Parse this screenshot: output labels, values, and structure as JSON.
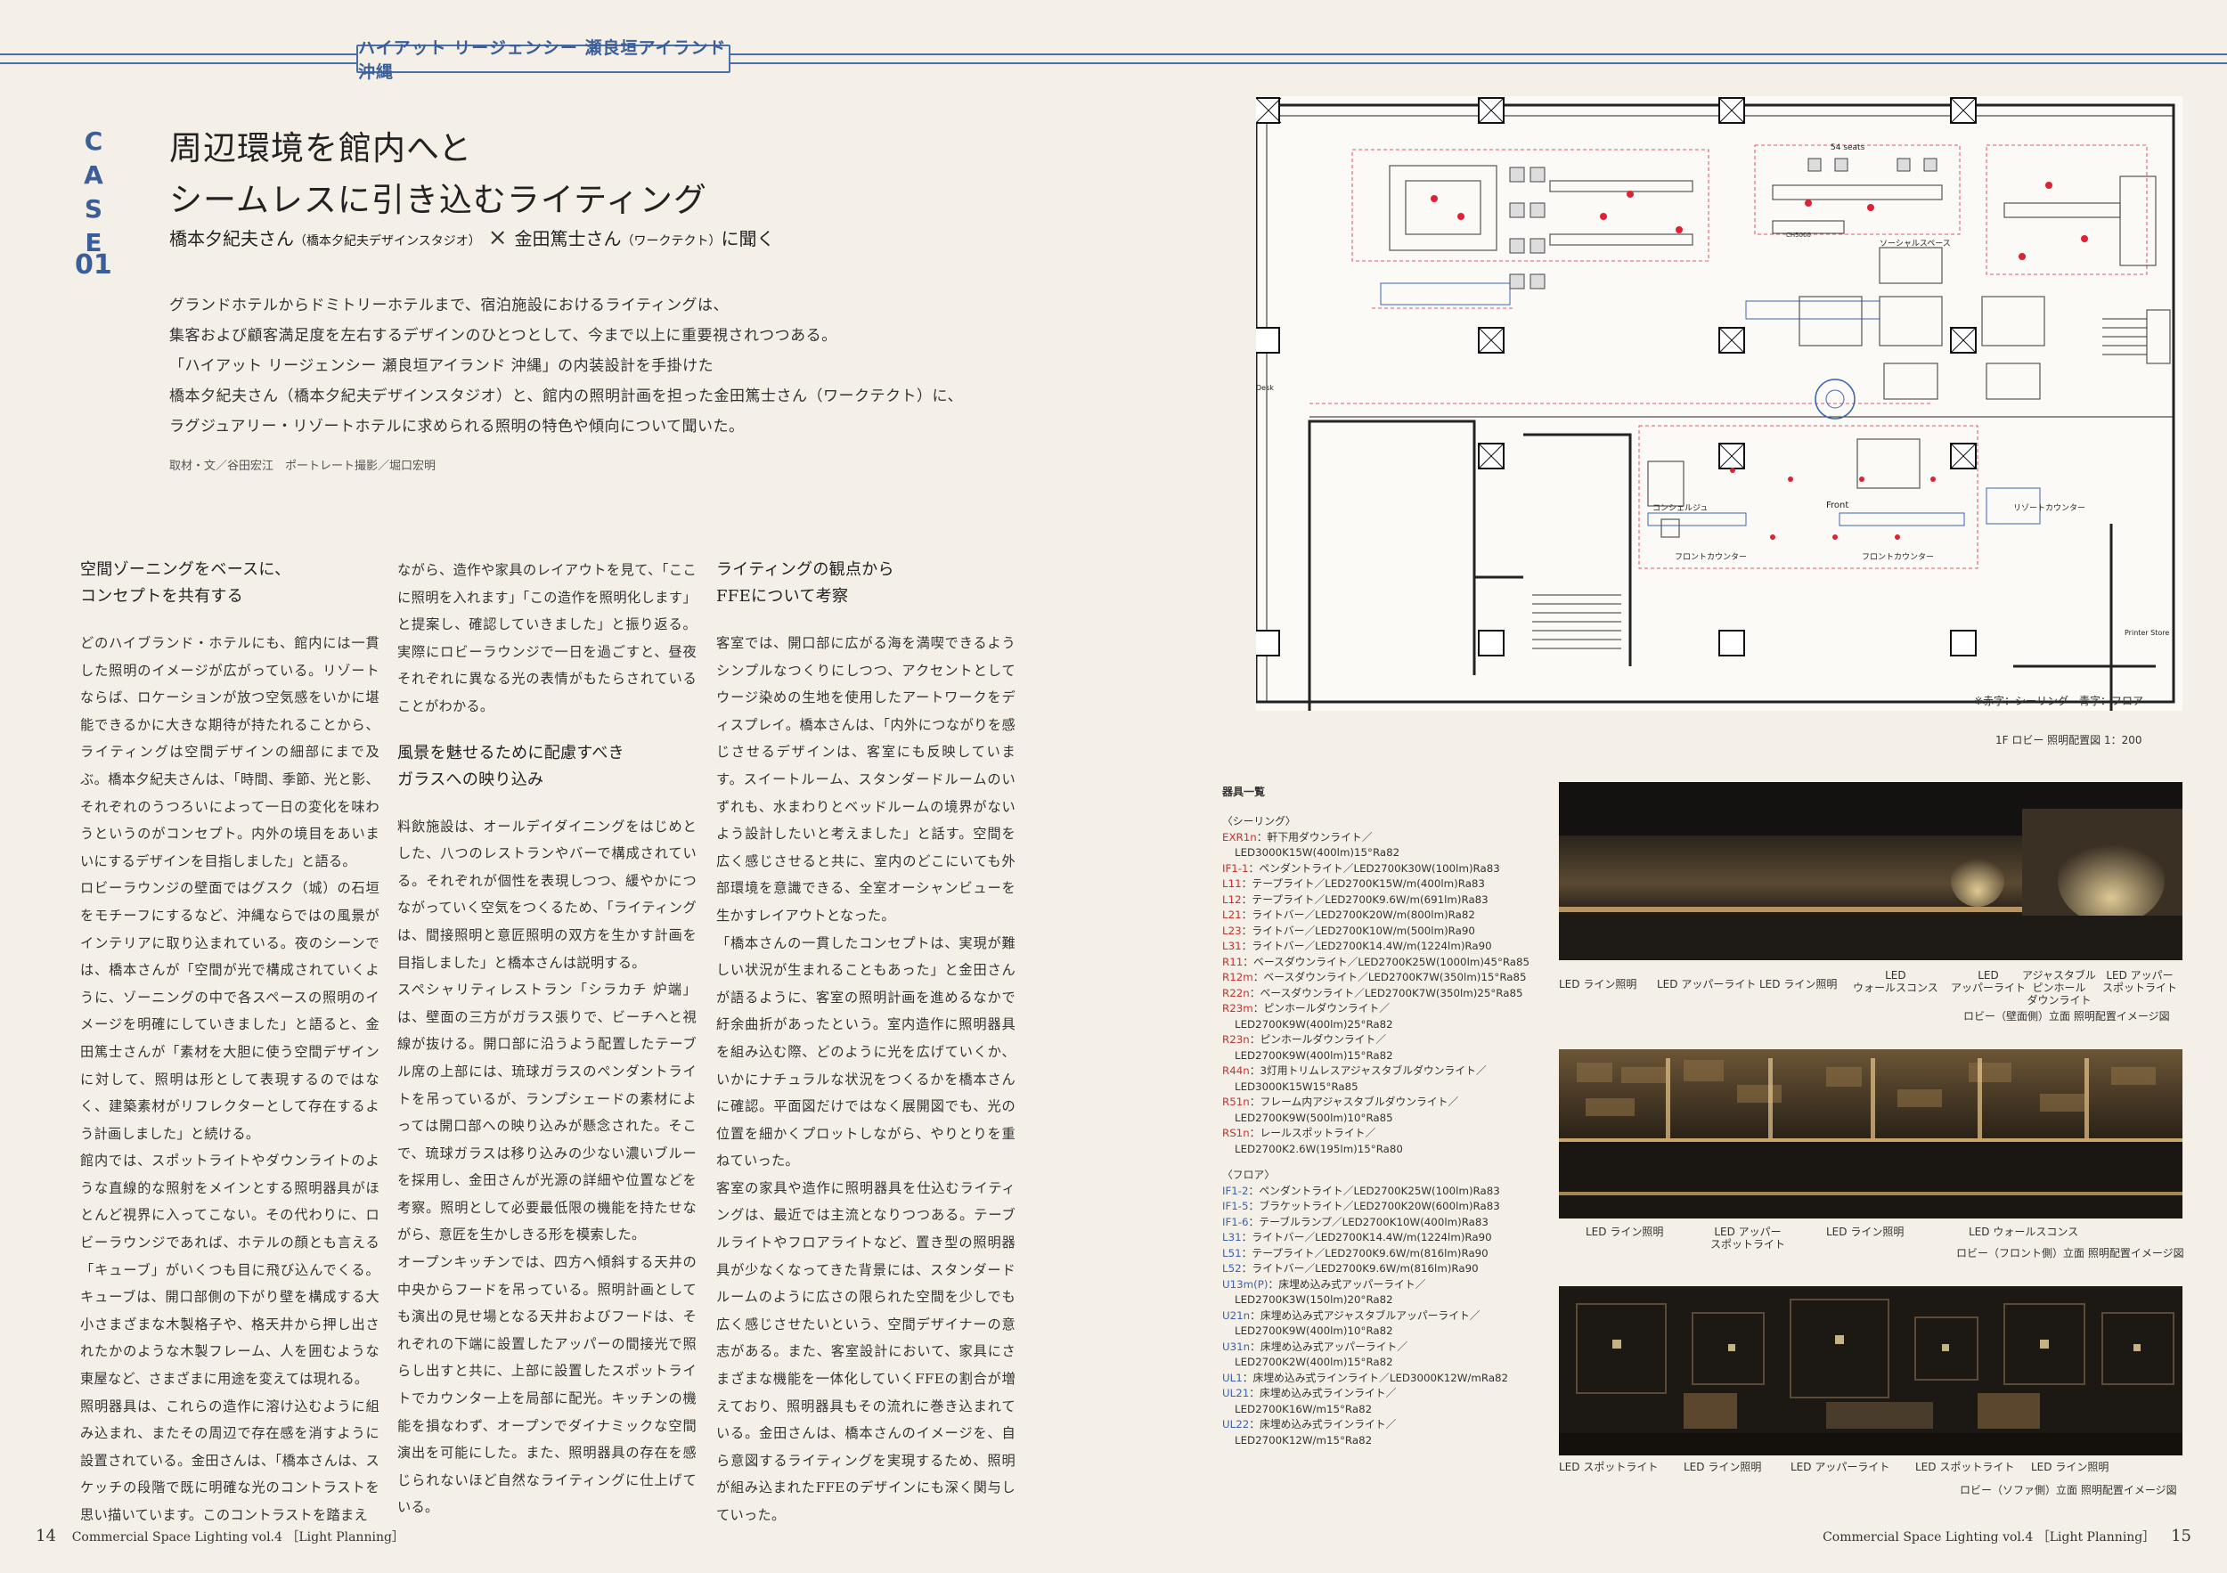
{
  "header": {
    "banner": "ハイアット リージェンシー 瀬良垣アイランド 沖縄"
  },
  "case": {
    "letters": [
      "C",
      "A",
      "S",
      "E"
    ],
    "number": "01"
  },
  "title": {
    "line1": "周辺環境を館内へと",
    "line2": "シームレスに引き込むライティング"
  },
  "people": {
    "person1": "橋本夕紀夫さん",
    "person1_org": "（橋本夕紀夫デザインスタジオ）",
    "cross": "×",
    "person2": "金田篤士さん",
    "person2_org": "（ワークテクト）",
    "suffix": "に聞く"
  },
  "lead": [
    "グランドホテルからドミトリーホテルまで、宿泊施設におけるライティングは、",
    "集客および顧客満足度を左右するデザインのひとつとして、今まで以上に重要視されつつある。",
    "「ハイアット リージェンシー 瀬良垣アイランド 沖縄」の内装設計を手掛けた",
    "橋本夕紀夫さん（橋本夕紀夫デザインスタジオ）と、館内の照明計画を担った金田篤士さん（ワークテクト）に、",
    "ラグジュアリー・リゾートホテルに求められる照明の特色や傾向について聞いた。"
  ],
  "credit": "取材・文／谷田宏江　ポートレート撮影／堀口宏明",
  "col1": {
    "heading": [
      "空間ゾーニングをベースに、",
      "コンセプトを共有する"
    ],
    "paragraphs": [
      "どのハイブランド・ホテルにも、館内には一貫した照明のイメージが広がっている。リゾートならば、ロケーションが放つ空気感をいかに堪能できるかに大きな期待が持たれることから、ライティングは空間デザインの細部にまで及ぶ。橋本夕紀夫さんは、「時間、季節、光と影、それぞれのうつろいによって一日の変化を味わうというのがコンセプト。内外の境目をあいまいにするデザインを目指しました」と語る。",
      "ロビーラウンジの壁面ではグスク（城）の石垣をモチーフにするなど、沖縄ならではの風景がインテリアに取り込まれている。夜のシーンでは、橋本さんが「空間が光で構成されていくように、ゾーニングの中で各スペースの照明のイメージを明確にしていきました」と語ると、金田篤士さんが「素材を大胆に使う空間デザインに対して、照明は形として表現するのではなく、建築素材がリフレクターとして存在するよう計画しました」と続ける。",
      "館内では、スポットライトやダウンライトのような直線的な照射をメインとする照明器具がほとんど視界に入ってこない。その代わりに、ロビーラウンジであれば、ホテルの顔とも言える「キューブ」がいくつも目に飛び込んでくる。キューブは、開口部側の下がり壁を構成する大小さまざまな木製格子や、格天井から押し出されたかのような木製フレーム、人を囲むような東屋など、さまざまに用途を変えては現れる。",
      "照明器具は、これらの造作に溶け込むように組み込まれ、またその周辺で存在感を消すように設置されている。金田さんは、「橋本さんは、スケッチの段階で既に明確な光のコントラストを思い描いています。このコントラストを踏まえ"
    ]
  },
  "col2": {
    "paragraphs_a": [
      "ながら、造作や家具のレイアウトを見て、「ここに照明を入れます」「この造作を照明化します」と提案し、確認していきました」と振り返る。実際にロビーラウンジで一日を過ごすと、昼夜それぞれに異なる光の表情がもたらされていることがわかる。"
    ],
    "heading": [
      "風景を魅せるために配慮すべき",
      "ガラスへの映り込み"
    ],
    "paragraphs_b": [
      "料飲施設は、オールデイダイニングをはじめとした、八つのレストランやバーで構成されている。それぞれが個性を表現しつつ、緩やかにつながっていく空気をつくるため、「ライティングは、間接照明と意匠照明の双方を生かす計画を目指しました」と橋本さんは説明する。",
      "スペシャリティレストラン「シラカチ 炉端」は、壁面の三方がガラス張りで、ビーチへと視線が抜ける。開口部に沿うよう配置したテーブル席の上部には、琉球ガラスのペンダントライトを吊っているが、ランプシェードの素材によっては開口部への映り込みが懸念された。そこで、琉球ガラスは移り込みの少ない濃いブルーを採用し、金田さんが光源の詳細や位置などを考察。照明として必要最低限の機能を持たせながら、意匠を生かしきる形を模索した。",
      "オープンキッチンでは、四方へ傾斜する天井の中央からフードを吊っている。照明計画としても演出の見せ場となる天井およびフードは、それぞれの下端に設置したアッパーの間接光で照らし出すと共に、上部に設置したスポットライトでカウンター上を局部に配光。キッチンの機能を損なわず、オープンでダイナミックな空間演出を可能にした。また、照明器具の存在を感じられないほど自然なライティングに仕上げている。"
    ]
  },
  "col3": {
    "heading": [
      "ライティングの観点から",
      "FFEについて考察"
    ],
    "paragraphs": [
      "客室では、開口部に広がる海を満喫できるようシンプルなつくりにしつつ、アクセントとしてウージ染めの生地を使用したアートワークをディスプレイ。橋本さんは、「内外につながりを感じさせるデザインは、客室にも反映しています。スイートルーム、スタンダードルームのいずれも、水まわりとベッドルームの境界がないよう設計したいと考えました」と話す。空間を広く感じさせると共に、室内のどこにいても外部環境を意識できる、全室オーシャンビューを生かすレイアウトとなった。",
      "「橋本さんの一貫したコンセプトは、実現が難しい状況が生まれることもあった」と金田さんが語るように、客室の照明計画を進めるなかで紆余曲折があったという。室内造作に照明器具を組み込む際、どのように光を広げていくか、いかにナチュラルな状況をつくるかを橋本さんに確認。平面図だけではなく展開図でも、光の位置を細かくプロットしながら、やりとりを重ねていった。",
      "客室の家具や造作に照明器具を仕込むライティングは、最近では主流となりつつある。テーブルライトやフロアライトなど、置き型の照明器具が少なくなってきた背景には、スタンダードルームのように広さの限られた空間を少しでも広く感じさせたいという、空間デザイナーの意志がある。また、客室設計において、家具にさまざまな機能を一体化していくFFEの割合が増えており、照明器具もその流れに巻き込まれている。金田さんは、橋本さんのイメージを、自ら意図するライティングを実現するため、照明が組み込まれたFFEのデザインにも深く関与していった。"
    ]
  },
  "plan": {
    "labels": {
      "seats": "54 seats",
      "social_space": "ソーシャルスペース",
      "front": "Front",
      "concierge": "コンシェルジュ",
      "front_counter1": "フロントカウンター",
      "front_counter2": "フロントカウンター",
      "resort_counter": "リゾートカウンター",
      "desk": "Desk",
      "printer": "Printer Store",
      "ch": "CH5000"
    },
    "note": "※赤字：シーリング　青字：フロア",
    "caption": "1F ロビー 照明配置図 1：200"
  },
  "fixtures": {
    "title": "器具一覧",
    "ceiling_heading": "〈シーリング〉",
    "ceiling": [
      {
        "code": "EXR1n",
        "desc": "：軒下用ダウンライト／",
        "spec": "LED3000K15W(400lm)15°Ra82"
      },
      {
        "code": "IF1-1",
        "desc": "：ペンダントライト／LED2700K30W(100lm)Ra83",
        "spec": ""
      },
      {
        "code": "L11",
        "desc": "：テープライト／LED2700K15W/m(400lm)Ra83",
        "spec": ""
      },
      {
        "code": "L12",
        "desc": "：テープライト／LED2700K9.6W/m(691lm)Ra83",
        "spec": ""
      },
      {
        "code": "L21",
        "desc": "：ライトバー／LED2700K20W/m(800lm)Ra82",
        "spec": ""
      },
      {
        "code": "L23",
        "desc": "：ライトバー／LED2700K10W/m(500lm)Ra90",
        "spec": ""
      },
      {
        "code": "L31",
        "desc": "：ライトバー／LED2700K14.4W/m(1224lm)Ra90",
        "spec": ""
      },
      {
        "code": "R11",
        "desc": "：ベースダウンライト／LED2700K25W(1000lm)45°Ra85",
        "spec": ""
      },
      {
        "code": "R12m",
        "desc": "：ベースダウンライト／LED2700K7W(350lm)15°Ra85",
        "spec": ""
      },
      {
        "code": "R22n",
        "desc": "：ベースダウンライト／LED2700K7W(350lm)25°Ra85",
        "spec": ""
      },
      {
        "code": "R23m",
        "desc": "：ピンホールダウンライト／",
        "spec": "LED2700K9W(400lm)25°Ra82"
      },
      {
        "code": "R23n",
        "desc": "：ピンホールダウンライト／",
        "spec": "LED2700K9W(400lm)15°Ra82"
      },
      {
        "code": "R44n",
        "desc": "：3灯用トリムレスアジャスタブルダウンライト／",
        "spec": "LED3000K15W15°Ra85"
      },
      {
        "code": "R51n",
        "desc": "：フレーム内アジャスタブルダウンライト／",
        "spec": "LED2700K9W(500lm)10°Ra85"
      },
      {
        "code": "RS1n",
        "desc": "：レールスポットライト／",
        "spec": "LED2700K2.6W(195lm)15°Ra80"
      }
    ],
    "floor_heading": "〈フロア〉",
    "floor": [
      {
        "code": "IF1-2",
        "desc": "：ペンダントライト／LED2700K25W(100lm)Ra83",
        "spec": ""
      },
      {
        "code": "IF1-5",
        "desc": "：ブラケットライト／LED2700K20W(600lm)Ra83",
        "spec": ""
      },
      {
        "code": "IF1-6",
        "desc": "：テーブルランプ／LED2700K10W(400lm)Ra83",
        "spec": ""
      },
      {
        "code": "L31",
        "desc": "：ライトバー／LED2700K14.4W/m(1224lm)Ra90",
        "spec": ""
      },
      {
        "code": "L51",
        "desc": "：テープライト／LED2700K9.6W/m(816lm)Ra90",
        "spec": ""
      },
      {
        "code": "L52",
        "desc": "：ライトバー／LED2700K9.6W/m(816lm)Ra90",
        "spec": ""
      },
      {
        "code": "U13m(P)",
        "desc": "：床埋め込み式アッパーライト／",
        "spec": "LED2700K3W(150lm)20°Ra82"
      },
      {
        "code": "U21n",
        "desc": "：床埋め込み式アジャスタブルアッパーライト／",
        "spec": "LED2700K9W(400lm)10°Ra82"
      },
      {
        "code": "U31n",
        "desc": "：床埋め込み式アッパーライト／",
        "spec": "LED2700K2W(400lm)15°Ra82"
      },
      {
        "code": "UL1",
        "desc": "：床埋め込み式ラインライト／LED3000K12W/mRa82",
        "spec": ""
      },
      {
        "code": "UL21",
        "desc": "：床埋め込み式ラインライト／",
        "spec": "LED2700K16W/m15°Ra82"
      },
      {
        "code": "UL22",
        "desc": "：床埋め込み式ラインライト／",
        "spec": "LED2700K12W/m15°Ra82"
      }
    ]
  },
  "panels": {
    "p1": {
      "labels": [
        "LED ライン照明",
        "LED アッパーライト",
        "LED ライン照明",
        "LED\nウォールスコンス",
        "LED\nアッパーライト",
        "アジャスタブル\nピンホール\nダウンライト",
        "LED アッパー\nスポットライト"
      ],
      "caption": "ロビー（壁面側）立面 照明配置イメージ図"
    },
    "p2": {
      "labels": [
        "LED ライン照明",
        "LED アッパー\nスポットライト",
        "LED ライン照明",
        "LED ウォールスコンス"
      ],
      "caption": "ロビー（フロント側）立面 照明配置イメージ図"
    },
    "p3": {
      "labels": [
        "LED スポットライト",
        "LED ライン照明",
        "LED アッパーライト",
        "LED スポットライト",
        "LED ライン照明"
      ],
      "caption": "ロビー（ソファ側）立面 照明配置イメージ図"
    }
  },
  "folio": {
    "left_page": "14",
    "left_text": "Commercial Space Lighting vol.4 ［Light Planning］",
    "right_text": "Commercial Space Lighting vol.4 ［Light Planning］",
    "right_page": "15"
  }
}
